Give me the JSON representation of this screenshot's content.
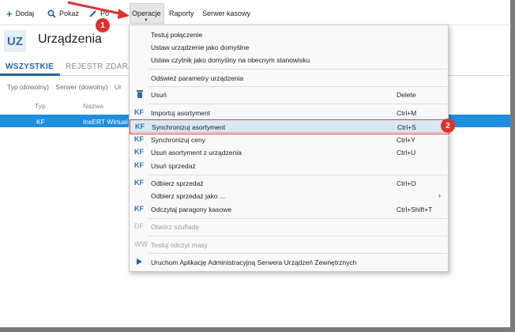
{
  "toolbar": {
    "dodaj_label": "Dodaj",
    "pokaz_label": "Pokaż",
    "popraw_label": "Po",
    "operacje_label": "Operacje",
    "raporty_label": "Raporty",
    "serwer_label": "Serwer kasowy"
  },
  "header": {
    "badge": "UZ",
    "title": "Urządzenia"
  },
  "tabs": [
    {
      "label": "WSZYSTKIE",
      "active": true
    },
    {
      "label": "REJESTR ZDARZEŃ",
      "active": false
    }
  ],
  "filters": [
    "Typ (dowolny)",
    "Serwer (dowolny)",
    "Ur"
  ],
  "grid": {
    "columns": [
      "Typ",
      "Nazwa"
    ],
    "rows": [
      {
        "typ": "KF",
        "nazwa": "InsERT Wirtual"
      }
    ]
  },
  "menu": {
    "items": [
      {
        "label": "Testuj połączenie"
      },
      {
        "label": "Ustaw urządzenie jako domyślne"
      },
      {
        "label": "Ustaw czytnik jako domyślny na obecnym stanowisku"
      },
      {
        "label": "Odśwież parametry urządzenia"
      },
      {
        "label": "Usuń",
        "shortcut": "Delete",
        "icon": "trash-icon"
      },
      {
        "label": "Importuj asortyment",
        "shortcut": "Ctrl+M",
        "icon": "KF"
      },
      {
        "label": "Synchronizuj asortyment",
        "shortcut": "Ctrl+S",
        "icon": "KF"
      },
      {
        "label": "Synchronizuj ceny",
        "shortcut": "Ctrl+Y",
        "icon": "KF"
      },
      {
        "label": "Usuń asortyment z urządzenia",
        "shortcut": "Ctrl+U",
        "icon": "KF"
      },
      {
        "label": "Usuń sprzedaż",
        "icon": "KF"
      },
      {
        "label": "Odbierz sprzedaż",
        "shortcut": "Ctrl+O",
        "icon": "KF"
      },
      {
        "label": "Odbierz sprzedaż jako ..."
      },
      {
        "label": "Odczytaj paragony kasowe",
        "shortcut": "Ctrl+Shift+T",
        "icon": "KF"
      },
      {
        "label": "Otwórz szufladę",
        "icon": "DF",
        "disabled": true
      },
      {
        "label": "Testuj odczyt masy",
        "icon": "WW",
        "disabled": true
      },
      {
        "label": "Uruchom Aplikację Administracyjną Serwera Urządzeń Zewnętrznych",
        "icon": "play-icon"
      }
    ]
  },
  "annotations": {
    "step1": "1",
    "step2": "2"
  },
  "colors": {
    "accent": "#1f63a8",
    "selection": "#1e8ee0",
    "annotation_red": "#e03131"
  }
}
